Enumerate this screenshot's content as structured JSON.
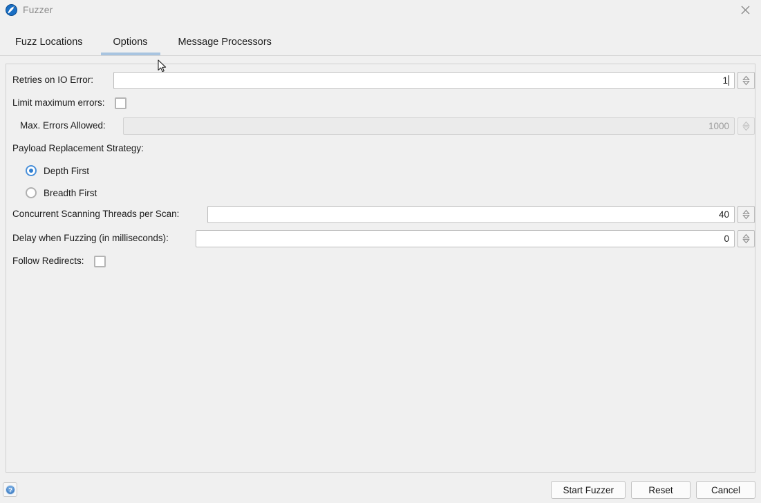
{
  "window": {
    "title": "Fuzzer",
    "app_icon": "zap-logo-icon",
    "close_label": "✕"
  },
  "tabs": [
    {
      "label": "Fuzz Locations",
      "selected": false
    },
    {
      "label": "Options",
      "selected": true
    },
    {
      "label": "Message Processors",
      "selected": false
    }
  ],
  "options": {
    "retries_on_io_error": {
      "label": "Retries on IO Error:",
      "value": "1"
    },
    "limit_maximum_errors": {
      "label": "Limit maximum errors:",
      "checked": false
    },
    "max_errors_allowed": {
      "label": "Max. Errors Allowed:",
      "value": "1000",
      "enabled": false
    },
    "payload_replacement_strategy": {
      "label": "Payload Replacement Strategy:",
      "options": [
        {
          "label": "Depth First",
          "selected": true
        },
        {
          "label": "Breadth First",
          "selected": false
        }
      ]
    },
    "concurrent_scanning_threads": {
      "label": "Concurrent Scanning Threads per Scan:",
      "value": "40"
    },
    "delay_when_fuzzing": {
      "label": "Delay when Fuzzing (in milliseconds):",
      "value": "0"
    },
    "follow_redirects": {
      "label": "Follow Redirects:",
      "checked": false
    }
  },
  "footer": {
    "help_icon": "help-question-icon",
    "buttons": [
      {
        "label": "Start Fuzzer"
      },
      {
        "label": "Reset"
      },
      {
        "label": "Cancel"
      }
    ]
  },
  "colors": {
    "accent": "#a8c4e0",
    "radio_selected": "#2f7ed0",
    "window_bg": "#f0f0f0",
    "field_bg": "#ffffff",
    "disabled_text": "#9a9a9a"
  }
}
